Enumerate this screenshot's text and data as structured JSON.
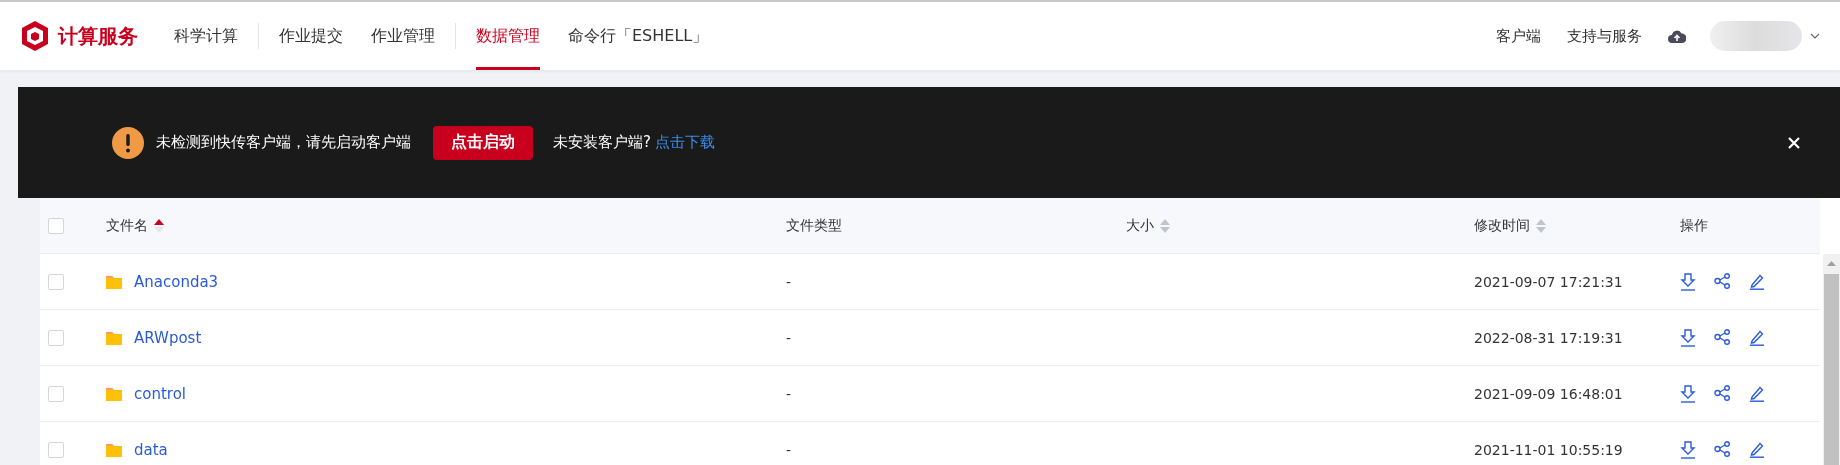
{
  "header": {
    "brand": "计算服务",
    "nav_groups": [
      [
        {
          "label": "科学计算",
          "selected": false
        }
      ],
      [
        {
          "label": "作业提交",
          "selected": false
        },
        {
          "label": "作业管理",
          "selected": false
        }
      ],
      [
        {
          "label": "数据管理",
          "selected": true
        },
        {
          "label": "命令行「ESHELL」",
          "selected": false
        }
      ]
    ],
    "right_links": [
      "客户端",
      "支持与服务"
    ]
  },
  "notice": {
    "message": "未检测到快传客户端，请先启动客户端",
    "button": "点击启动",
    "hint": "未安装客户端?",
    "link": "点击下载"
  },
  "table": {
    "select_all_checked": false,
    "columns": [
      {
        "label": "文件名",
        "sortable": true,
        "sorted": true
      },
      {
        "label": "文件类型",
        "sortable": false
      },
      {
        "label": "大小",
        "sortable": true,
        "sorted": false
      },
      {
        "label": "修改时间",
        "sortable": true,
        "sorted": false
      },
      {
        "label": "操作",
        "sortable": false
      }
    ],
    "rows": [
      {
        "name": "Anaconda3",
        "type": "-",
        "modified": "2021-09-07 17:21:31",
        "checked": false
      },
      {
        "name": "ARWpost",
        "type": "-",
        "modified": "2022-08-31 17:19:31",
        "checked": false
      },
      {
        "name": "control",
        "type": "-",
        "modified": "2021-09-09 16:48:01",
        "checked": false
      },
      {
        "name": "data",
        "type": "-",
        "modified": "2021-11-01 10:55:19",
        "checked": false
      }
    ]
  }
}
